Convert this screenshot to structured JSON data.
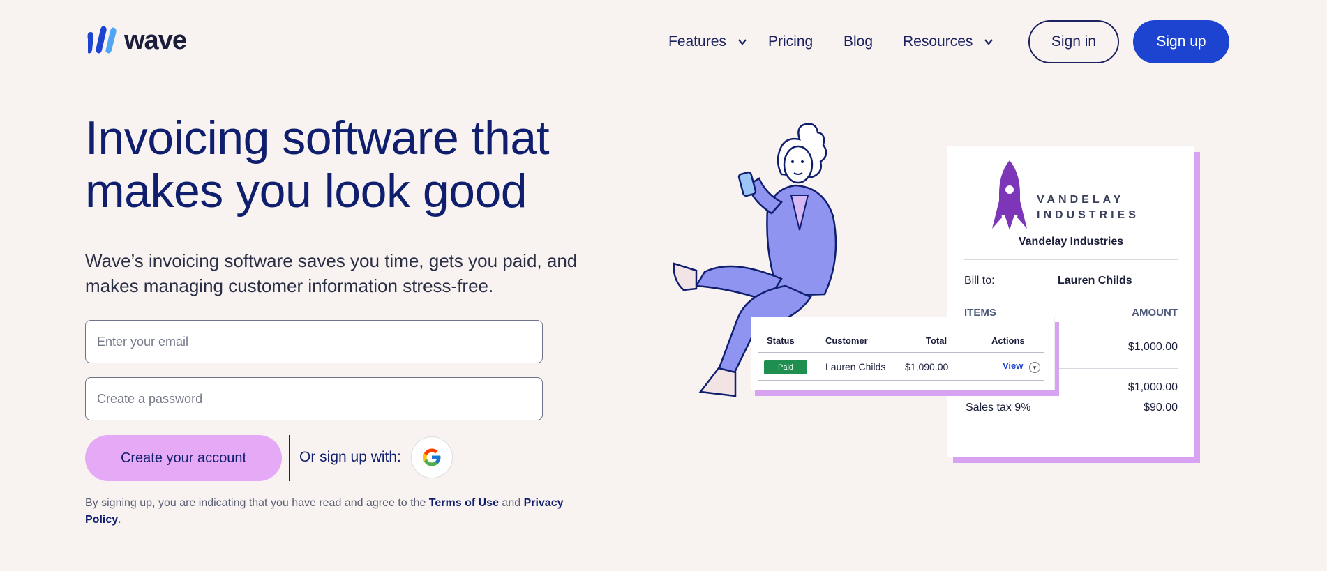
{
  "brand": {
    "name": "wave"
  },
  "nav": {
    "features": "Features",
    "pricing": "Pricing",
    "blog": "Blog",
    "resources": "Resources",
    "sign_in": "Sign in",
    "sign_up": "Sign up"
  },
  "hero": {
    "title": "Invoicing software that makes you look good",
    "subtitle": "Wave’s invoicing software saves you time, gets you paid, and makes managing customer information stress-free."
  },
  "form": {
    "email_placeholder": "Enter your email",
    "password_placeholder": "Create a password",
    "create_label": "Create your account",
    "or_label": "Or sign up with:",
    "legal_prefix": "By signing up, you are indicating that you have read and agree to the ",
    "terms_label": "Terms of Use",
    "legal_and": " and ",
    "privacy_label": "Privacy Policy",
    "legal_suffix": "."
  },
  "invoice": {
    "brand_line1": "VANDELAY",
    "brand_line2": "INDUSTRIES",
    "company": "Vandelay Industries",
    "bill_to_label": "Bill to:",
    "bill_to_name": "Lauren Childs",
    "items_header": "ITEMS",
    "amount_header": "AMOUNT",
    "item_amount": "$1,000.00",
    "subtotal": "$1,000.00",
    "tax_label": "Sales tax 9%",
    "tax_amount": "$90.00"
  },
  "table": {
    "headers": {
      "status": "Status",
      "customer": "Customer",
      "total": "Total",
      "actions": "Actions"
    },
    "row": {
      "status": "Paid",
      "customer": "Lauren Childs",
      "total": "$1,090.00",
      "action": "View"
    }
  },
  "colors": {
    "background": "#f8f2f1",
    "primary": "#1c44d1",
    "navy": "#0f1f6e",
    "accent_pink": "#e6a9f6",
    "paid_green": "#1e8f4e",
    "illustration_purple": "#8f94f0"
  }
}
